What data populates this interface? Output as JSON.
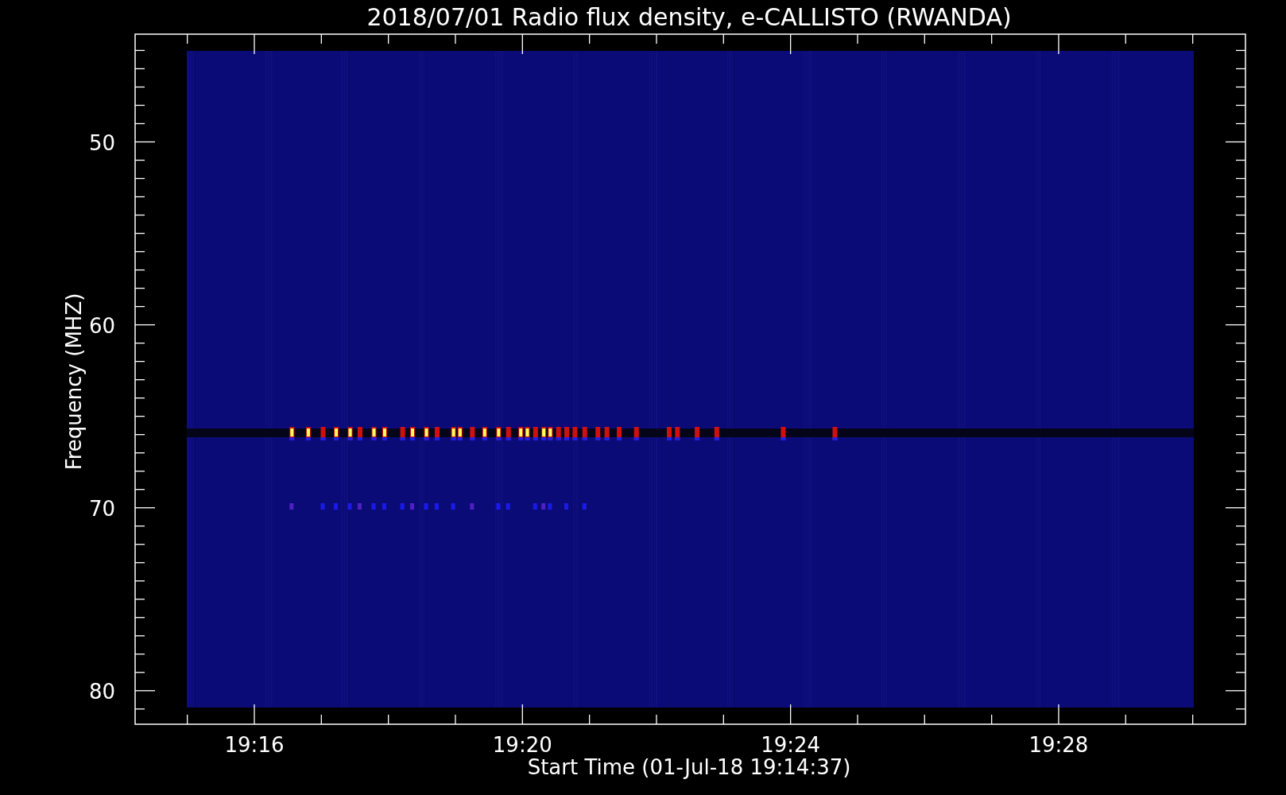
{
  "title": "2018/07/01  Radio flux density, e-CALLISTO (RWANDA)",
  "xlabel": "Start Time (01-Jul-18 19:14:37)",
  "ylabel": "Frequency (MHZ)",
  "yticks": [
    "50",
    "60",
    "70",
    "80"
  ],
  "xticks": [
    "19:16",
    "19:20",
    "19:24",
    "19:28"
  ]
}
